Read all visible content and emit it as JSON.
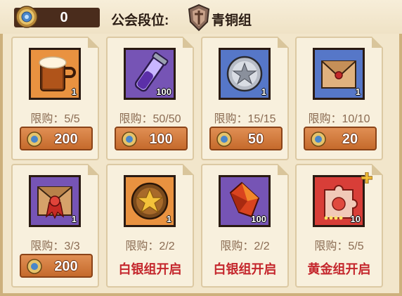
{
  "header": {
    "currency_icon": "guild-coin-icon",
    "currency_value": "0",
    "rank_label": "公会段位:",
    "rank_emblem_icon": "bronze-shield-emblem-icon",
    "rank_name": "青铜组"
  },
  "colors": {
    "background": "#f2e6cb",
    "button": "#d87c3e",
    "unlock_text": "#c4262c",
    "limit_text": "#8a6b52"
  },
  "items": [
    {
      "icon": "beer-mug-icon",
      "quantity": "1",
      "limit": "限购：5/5",
      "price": "200"
    },
    {
      "icon": "purple-vial-icon",
      "quantity": "100",
      "limit": "限购：50/50",
      "price": "100"
    },
    {
      "icon": "silver-star-coin-icon",
      "quantity": "1",
      "limit": "限购：15/15",
      "price": "50"
    },
    {
      "icon": "sealed-envelope-icon",
      "quantity": "1",
      "limit": "限购：10/10",
      "price": "20"
    },
    {
      "icon": "red-ribbon-envelope-icon",
      "quantity": "1",
      "limit": "限购：3/3",
      "price": "200"
    },
    {
      "icon": "gold-star-coin-icon",
      "quantity": "1",
      "limit": "限购：2/2",
      "unlock": "白银组开启"
    },
    {
      "icon": "fire-crystal-icon",
      "quantity": "100",
      "limit": "限购：2/2",
      "unlock": "白银组开启"
    },
    {
      "icon": "red-puzzle-token-icon",
      "quantity": "10",
      "limit": "限购：5/5",
      "unlock": "黄金组开启"
    }
  ]
}
